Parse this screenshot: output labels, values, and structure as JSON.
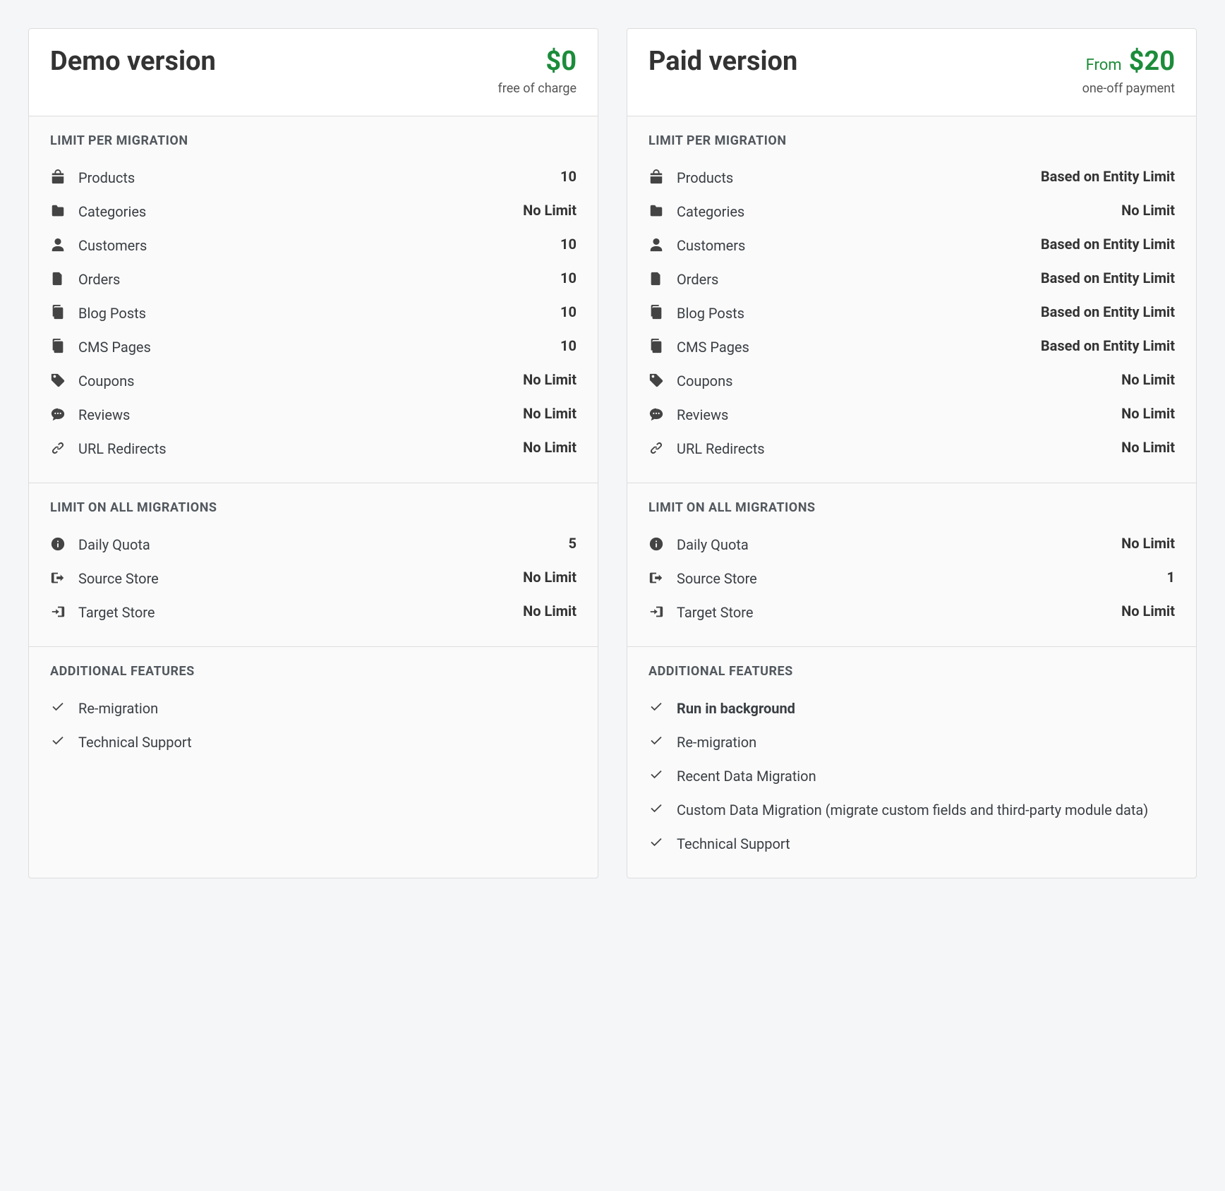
{
  "plans": [
    {
      "title": "Demo version",
      "price_pre": "",
      "price": "$0",
      "price_sub": "free of charge",
      "sections": [
        {
          "title": "LIMIT PER MIGRATION",
          "rows": [
            {
              "icon": "bag",
              "label": "Products",
              "val": "10"
            },
            {
              "icon": "folder",
              "label": "Categories",
              "val": "No Limit"
            },
            {
              "icon": "user",
              "label": "Customers",
              "val": "10"
            },
            {
              "icon": "file",
              "label": "Orders",
              "val": "10"
            },
            {
              "icon": "copy",
              "label": "Blog Posts",
              "val": "10"
            },
            {
              "icon": "copy",
              "label": "CMS Pages",
              "val": "10"
            },
            {
              "icon": "tag",
              "label": "Coupons",
              "val": "No Limit"
            },
            {
              "icon": "comment",
              "label": "Reviews",
              "val": "No Limit"
            },
            {
              "icon": "link",
              "label": "URL Redirects",
              "val": "No Limit"
            }
          ]
        },
        {
          "title": "LIMIT ON ALL MIGRATIONS",
          "rows": [
            {
              "icon": "info",
              "label": "Daily Quota",
              "val": "5"
            },
            {
              "icon": "signout",
              "label": "Source Store",
              "val": "No Limit"
            },
            {
              "icon": "signin",
              "label": "Target Store",
              "val": "No Limit"
            }
          ]
        },
        {
          "title": "ADDITIONAL FEATURES",
          "rows": [
            {
              "icon": "check",
              "label": "Re-migration",
              "val": ""
            },
            {
              "icon": "check",
              "label": "Technical Support",
              "val": ""
            }
          ]
        }
      ]
    },
    {
      "title": "Paid version",
      "price_pre": "From",
      "price": "$20",
      "price_sub": "one-off payment",
      "sections": [
        {
          "title": "LIMIT PER MIGRATION",
          "rows": [
            {
              "icon": "bag",
              "label": "Products",
              "val": "Based on Entity Limit"
            },
            {
              "icon": "folder",
              "label": "Categories",
              "val": "No Limit"
            },
            {
              "icon": "user",
              "label": "Customers",
              "val": "Based on Entity Limit"
            },
            {
              "icon": "file",
              "label": "Orders",
              "val": "Based on Entity Limit"
            },
            {
              "icon": "copy",
              "label": "Blog Posts",
              "val": "Based on Entity Limit"
            },
            {
              "icon": "copy",
              "label": "CMS Pages",
              "val": "Based on Entity Limit"
            },
            {
              "icon": "tag",
              "label": "Coupons",
              "val": "No Limit"
            },
            {
              "icon": "comment",
              "label": "Reviews",
              "val": "No Limit"
            },
            {
              "icon": "link",
              "label": "URL Redirects",
              "val": "No Limit"
            }
          ]
        },
        {
          "title": "LIMIT ON ALL MIGRATIONS",
          "rows": [
            {
              "icon": "info",
              "label": "Daily Quota",
              "val": "No Limit"
            },
            {
              "icon": "signout",
              "label": "Source Store",
              "val": "1"
            },
            {
              "icon": "signin",
              "label": "Target Store",
              "val": "No Limit"
            }
          ]
        },
        {
          "title": "ADDITIONAL FEATURES",
          "rows": [
            {
              "icon": "check",
              "label": "Run in background",
              "val": "",
              "bold": true
            },
            {
              "icon": "check",
              "label": "Re-migration",
              "val": ""
            },
            {
              "icon": "check",
              "label": "Recent Data Migration",
              "val": ""
            },
            {
              "icon": "check",
              "label": "Custom Data Migration (migrate custom fields and third-party module data)",
              "val": ""
            },
            {
              "icon": "check",
              "label": "Technical Support",
              "val": ""
            }
          ]
        }
      ]
    }
  ]
}
